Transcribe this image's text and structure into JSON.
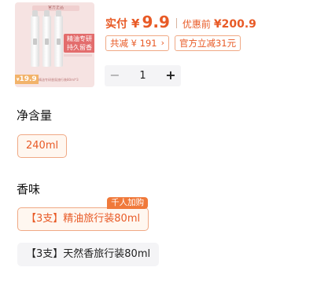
{
  "product": {
    "thumbnail": {
      "banner_text": "官方正品",
      "tag_text": "精油专研 持久留香",
      "price": "19.9",
      "currency": "¥",
      "footer_text": "精油专研香氛旅行装80ml*3",
      "colors": {
        "background": "#f6e3e2",
        "tag": "#e36d6d",
        "price_tag": "#f2b36a"
      }
    },
    "actual_label": "实付",
    "currency": "¥",
    "actual_price": "9.9",
    "before_label": "优惠前",
    "before_price": "¥200.9",
    "promos": [
      {
        "text": "共减 ¥ 191",
        "has_chevron": true,
        "chevron": "›"
      },
      {
        "text": "官方立减31元",
        "has_chevron": false
      }
    ],
    "quantity": {
      "minus_icon": "minus-icon",
      "minus_symbol": "−",
      "value": "1",
      "plus_icon": "plus-icon",
      "plus_symbol": "+"
    }
  },
  "sections": {
    "volume": {
      "title": "净含量",
      "options": [
        {
          "label": "240ml",
          "selected": true
        }
      ]
    },
    "scent": {
      "title": "香味",
      "options": [
        {
          "label": "【3支】精油旅行装80ml",
          "selected": true,
          "badge": "千人加购"
        },
        {
          "label": "【3支】天然香旅行装80ml",
          "selected": false
        }
      ]
    }
  },
  "colors": {
    "accent": "#e85a26",
    "accent_border": "#f0a985",
    "selected_bg": "#fff7f0",
    "chip_bg": "#f4f4f6",
    "badge_bg": "#f0793a"
  }
}
